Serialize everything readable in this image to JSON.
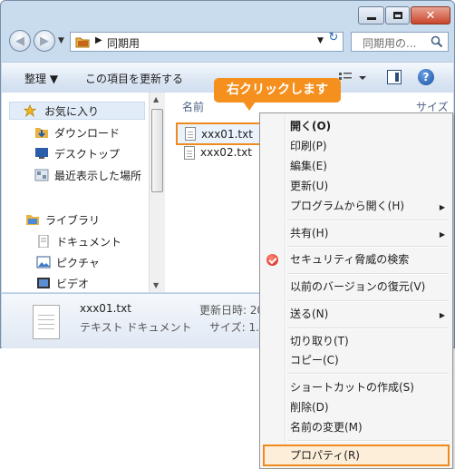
{
  "window": {
    "controls": [
      "minimize",
      "maximize",
      "close"
    ]
  },
  "nav": {
    "address_path": "同期用",
    "search_placeholder": "同期用の..."
  },
  "toolbar": {
    "organize": "整理 ▼",
    "update": "この項目を更新する"
  },
  "sidebar": {
    "items": [
      {
        "label": "お気に入り",
        "icon": "star-icon"
      },
      {
        "label": "ダウンロード",
        "icon": "download-folder-icon"
      },
      {
        "label": "デスクトップ",
        "icon": "desktop-icon"
      },
      {
        "label": "最近表示した場所",
        "icon": "recent-places-icon"
      },
      {
        "label": "ライブラリ",
        "icon": "library-icon"
      },
      {
        "label": "ドキュメント",
        "icon": "documents-icon"
      },
      {
        "label": "ピクチャ",
        "icon": "pictures-icon"
      },
      {
        "label": "ビデオ",
        "icon": "videos-icon"
      }
    ]
  },
  "filepane": {
    "col_name": "名前",
    "col_size": "サイズ",
    "files": [
      "xxx01.txt",
      "xxx02.txt"
    ]
  },
  "callout": "右クリックします",
  "details": {
    "name": "xxx01.txt",
    "type": "テキスト ドキュメント",
    "modified_label": "更新日時: 20",
    "size_label": "サイズ: 1.2"
  },
  "context_menu": {
    "open": "開く(O)",
    "print": "印刷(P)",
    "edit": "編集(E)",
    "update": "更新(U)",
    "open_with": "プログラムから開く(H)",
    "share": "共有(H)",
    "security_scan": "セキュリティ脅威の検索",
    "restore_previous": "以前のバージョンの復元(V)",
    "send_to": "送る(N)",
    "cut": "切り取り(T)",
    "copy": "コピー(C)",
    "create_shortcut": "ショートカットの作成(S)",
    "delete": "削除(D)",
    "rename": "名前の変更(M)",
    "properties": "プロパティ(R)"
  },
  "colors": {
    "highlight": "#f08a1c",
    "callout": "#f5901e",
    "window_frame": "#c9dcee"
  }
}
